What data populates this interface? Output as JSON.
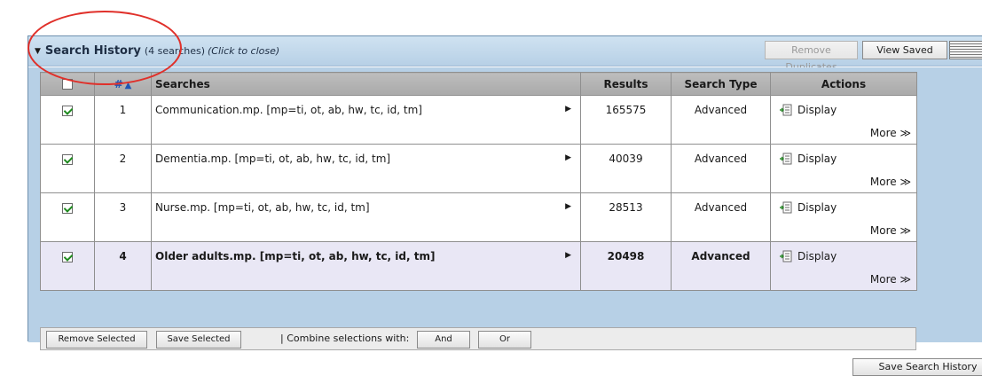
{
  "header": {
    "title": "Search History",
    "count": "(4 searches)",
    "hint": "(Click to close)",
    "remove_duplicates": "Remove Duplicates",
    "view_saved": "View Saved"
  },
  "table": {
    "columns": {
      "num": "#",
      "searches": "Searches",
      "results": "Results",
      "type": "Search Type",
      "actions": "Actions"
    },
    "sort_icon": "up-triangle",
    "rows": [
      {
        "num": "1",
        "query": "Communication.mp. [mp=ti, ot, ab, hw, tc, id, tm]",
        "results": "165575",
        "type": "Advanced",
        "display": "Display",
        "more": "More ≫",
        "checked": true
      },
      {
        "num": "2",
        "query": "Dementia.mp. [mp=ti, ot, ab, hw, tc, id, tm]",
        "results": "40039",
        "type": "Advanced",
        "display": "Display",
        "more": "More ≫",
        "checked": true
      },
      {
        "num": "3",
        "query": "Nurse.mp. [mp=ti, ot, ab, hw, tc, id, tm]",
        "results": "28513",
        "type": "Advanced",
        "display": "Display",
        "more": "More ≫",
        "checked": true
      },
      {
        "num": "4",
        "query": "Older adults.mp. [mp=ti, ot, ab, hw, tc, id, tm]",
        "results": "20498",
        "type": "Advanced",
        "display": "Display",
        "more": "More ≫",
        "checked": true
      }
    ]
  },
  "footer": {
    "remove_selected": "Remove Selected",
    "save_selected": "Save Selected",
    "combine_label": "| Combine selections with:",
    "and": "And",
    "or": "Or",
    "save_history": "Save Search History"
  },
  "colors": {
    "annotation": "#e0302a",
    "panel_blue": "#b7d0e6",
    "selected_row": "#e9e7f5"
  }
}
